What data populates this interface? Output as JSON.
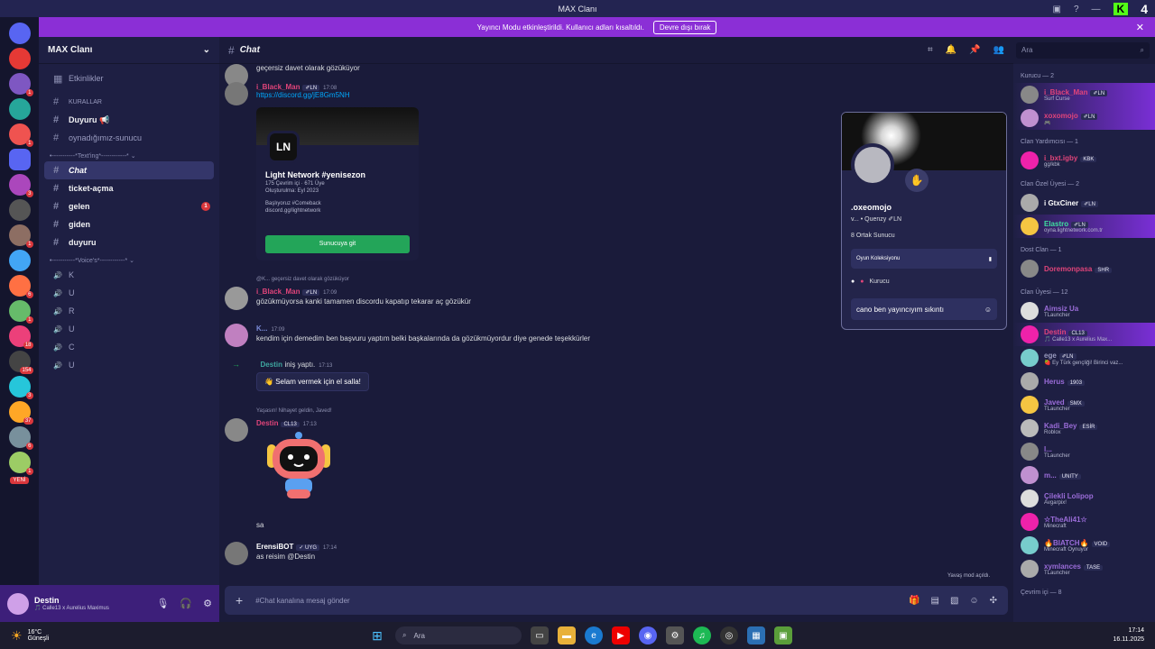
{
  "window": {
    "title": "MAX Clanı",
    "icons": [
      "monitor-icon",
      "help-icon",
      "minimize-icon",
      "kick-logo-icon"
    ],
    "kick_badge": "4"
  },
  "streamer_bar": {
    "text": "Yayıncı Modu etkinleştirildi. Kullanıcı adları kısaltıldı.",
    "button": "Devre dışı bırak"
  },
  "servers": {
    "badges": [
      "1",
      "1",
      "1",
      "1",
      "1",
      "3",
      "1",
      "1",
      "1",
      "6",
      "1",
      "18",
      "154",
      "3",
      "37",
      "6",
      "1"
    ],
    "new_label": "YENİ"
  },
  "sidebar": {
    "server_name": "MAX Clanı",
    "events": "Etkinlikler",
    "items": [
      {
        "kind": "channel",
        "label": "KURALLAR",
        "small": true
      },
      {
        "kind": "channel",
        "label": "Duyuru 📢",
        "bold": true
      },
      {
        "kind": "channel",
        "label": "oynadığımız-sunucu"
      },
      {
        "kind": "category",
        "label": "•-----------*Text'ing*------------* ⌄"
      },
      {
        "kind": "channel",
        "label": "Chat",
        "selected": true
      },
      {
        "kind": "channel",
        "label": "ticket-açma",
        "bold": true
      },
      {
        "kind": "channel",
        "label": "gelen",
        "bold": true,
        "unread": "1"
      },
      {
        "kind": "channel",
        "label": "giden",
        "bold": true
      },
      {
        "kind": "channel",
        "label": "duyuru",
        "bold": true
      },
      {
        "kind": "category",
        "label": "•-----------*Voice's*------------* ⌄"
      },
      {
        "kind": "voice",
        "label": "K"
      },
      {
        "kind": "voice",
        "label": "U"
      },
      {
        "kind": "voice",
        "label": "R"
      },
      {
        "kind": "voice",
        "label": "U"
      },
      {
        "kind": "voice",
        "label": "C"
      },
      {
        "kind": "voice",
        "label": "U"
      }
    ]
  },
  "user_panel": {
    "name": "Destin",
    "status": "🎵 Calle13 x Aurelius Maximus"
  },
  "chat_header": {
    "channel": "Chat",
    "search_placeholder": "Ara"
  },
  "messages": [
    {
      "top_text": "geçersiz davet olarak gözüküyor"
    },
    {
      "user": "i_Black_Man",
      "color": "#e0447a",
      "tag": "✐LN",
      "time": "17:08",
      "link": "https://discord.gg/jE8Gm5NH"
    },
    {
      "invite": {
        "name": "Light Network #yenisezon",
        "online": "175 Çevrim içi",
        "members": "671 Üye",
        "created": "Oluşturulma: Eyl 2023",
        "desc": "Başlıyoruz #Comeback",
        "url": "discord.gg/lightnetwork",
        "button": "Sunucuya git",
        "logo": "LN"
      }
    },
    {
      "reply": "@K... geçersiz davet olarak gözüküyor",
      "user": "i_Black_Man",
      "color": "#e0447a",
      "tag": "✐LN",
      "time": "17:09",
      "text": "gözükmüyorsa kanki tamamen discordu kapatıp tekarar aç gözükür"
    },
    {
      "user": "K...",
      "color": "#7a8bd8",
      "time": "17:09",
      "text": "kendim için demedim ben başvuru yaptım belki başkalarında da gözükmüyordur diye genede teşekkürler"
    },
    {
      "system": "Destin",
      "system_text": "iniş yaptı.",
      "time": "17:13",
      "wave": "Selam vermek için el salla!"
    },
    {
      "reply": "Yaşasın! Nihayet geldin, Javed!",
      "user": "Destin",
      "color": "#e0447a",
      "tag": "CL13",
      "time": "17:13",
      "text": "sa"
    },
    {
      "user": "ErensiBOT",
      "color": "#ffffff",
      "tag": "✓ UYG",
      "time": "17:14",
      "text": "as reisim @Destin"
    }
  ],
  "popout": {
    "name": ".oxeomojo",
    "line": "v... • Quenzy ✐LN",
    "mutual": "8 Ortak Sunucu",
    "collection": "Oyun Koleksiyonu",
    "role": "Kurucu",
    "input": "cano ben yayıncıyım sıkıntı"
  },
  "members": [
    {
      "group": "Kurucu — 2"
    },
    {
      "name": "i_Black_Man",
      "tag": "✐LN",
      "status": "Surf Curse",
      "color": "#e0447a",
      "hl": true
    },
    {
      "name": "xoxomojo",
      "tag": "✐LN",
      "status": "🎮",
      "color": "#e0447a",
      "hl": true
    },
    {
      "group": "Clan Yardımcısı — 1"
    },
    {
      "name": "i_bxt.igby",
      "tag": "KBK",
      "status": "gg/kbk",
      "color": "#e0447a"
    },
    {
      "group": "Clan Özel Üyesi — 2"
    },
    {
      "name": "i GtxCiner",
      "tag": "✐LN",
      "status": "",
      "color": "#ffffff"
    },
    {
      "name": "Elastro",
      "tag": "✐LN",
      "status": "oyna.lightnetwork.com.tr",
      "color": "#3fe0a0",
      "hl": true
    },
    {
      "group": "Dost Clan — 1"
    },
    {
      "name": "Doremonpasa",
      "tag": "SHR",
      "status": "",
      "color": "#e0447a"
    },
    {
      "group": "Clan Üyesi — 12"
    },
    {
      "name": "Aimsiz Ua",
      "tag": "",
      "status": "TLauncher",
      "color": "#9a6cd8"
    },
    {
      "name": "Destin",
      "tag": "CL13",
      "status": "🎵 Calle13 x Aurelius Max...",
      "color": "#e0447a",
      "hl": true
    },
    {
      "name": "ege",
      "tag": "✐LN",
      "status": "🍓 Ey Türk gençliği! Birinci vaz...",
      "color": "#9a9cc0"
    },
    {
      "name": "Herus",
      "tag": "1903",
      "status": "",
      "color": "#9a6cd8"
    },
    {
      "name": "Javed",
      "tag": "SMX",
      "status": "TLauncher",
      "color": "#9a6cd8"
    },
    {
      "name": "Kadi_Bey",
      "tag": "ESİR",
      "status": "Roblox",
      "color": "#9a6cd8"
    },
    {
      "name": "l...",
      "tag": "",
      "status": "TLauncher",
      "color": "#9a6cd8"
    },
    {
      "name": "m...",
      "tag": "UNITY",
      "status": "",
      "color": "#9a6cd8"
    },
    {
      "name": "Çilekli Lolipop",
      "tag": "",
      "status": "Avgarpix!",
      "color": "#9a6cd8"
    },
    {
      "name": "☆TheAli41☆",
      "tag": "",
      "status": "Minecraft",
      "color": "#9a6cd8"
    },
    {
      "name": "🔥BIATCH🔥",
      "tag": "VOID",
      "status": "Minecraft Oynuyor",
      "color": "#9a6cd8"
    },
    {
      "name": "xymlances",
      "tag": "TASE",
      "status": "TLauncher",
      "color": "#9a6cd8"
    },
    {
      "group": "Çevrim içi — 8"
    }
  ],
  "composer": {
    "placeholder": "#Chat kanalına mesaj gönder",
    "mode_hint": "Yavaş mod açıldı."
  },
  "taskbar": {
    "temp": "16°C",
    "weather": "Güneşli",
    "search": "Ara",
    "time": "17:14",
    "date": "16.11.2025"
  },
  "colors": {
    "accent": "#8b2fd6",
    "background": "#1a1b3a",
    "link": "#00a8fc",
    "green": "#23a559"
  }
}
